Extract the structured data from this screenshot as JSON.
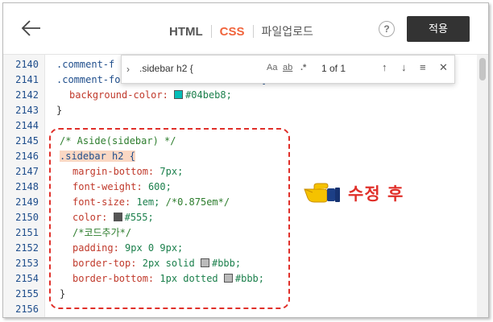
{
  "header": {
    "tabs": [
      {
        "label": "HTML",
        "active": false
      },
      {
        "label": "CSS",
        "active": true
      },
      {
        "label": "파일업로드",
        "active": false
      }
    ],
    "help_label": "?",
    "apply_label": "적용"
  },
  "find": {
    "query": ".sidebar h2 {",
    "opt_case": "Aa",
    "opt_word": "ab",
    "opt_regex": ".*",
    "count": "1 of 1",
    "prev": "↑",
    "next": "↓",
    "menu": "≡",
    "close": "✕"
  },
  "line_numbers": [
    "2140",
    "2141",
    "2142",
    "2143",
    "2144",
    "2145",
    "2146",
    "2147",
    "2148",
    "2149",
    "2150",
    "2151",
    "2152",
    "2153",
    "2154",
    "2155",
    "2156"
  ],
  "code": {
    "l2140": ".comment-f",
    "l2141": ".comment-form .submit-button:focus {",
    "l2142_prop": "background-color:",
    "l2142_val": "#04beb8;",
    "l2143": "}",
    "l2145": "/* Aside(sidebar) */",
    "l2146": ".sidebar h2 {",
    "l2147_prop": "margin-bottom:",
    "l2147_val": "7px;",
    "l2148_prop": "font-weight:",
    "l2148_val": "600;",
    "l2149_prop": "font-size:",
    "l2149_val": "1em;",
    "l2149_cmt": "/*0.875em*/",
    "l2150_prop": "color:",
    "l2150_val": "#555;",
    "l2151": "/*코드추가*/",
    "l2152_prop": "padding:",
    "l2152_val": "9px 0 9px;",
    "l2153_prop": "border-top:",
    "l2153_val": "2px solid",
    "l2153_col": "#bbb;",
    "l2154_prop": "border-bottom:",
    "l2154_val": "1px dotted",
    "l2154_col": "#bbb;",
    "l2155": "}"
  },
  "colors": {
    "swatch_teal": "#04beb8",
    "swatch_555": "#555555",
    "swatch_bbb": "#bbbbbb",
    "accent": "#f0643c",
    "annotation": "#e0302a"
  },
  "annotation": {
    "icon": "pointing-hand-icon",
    "text": "수정 후"
  }
}
